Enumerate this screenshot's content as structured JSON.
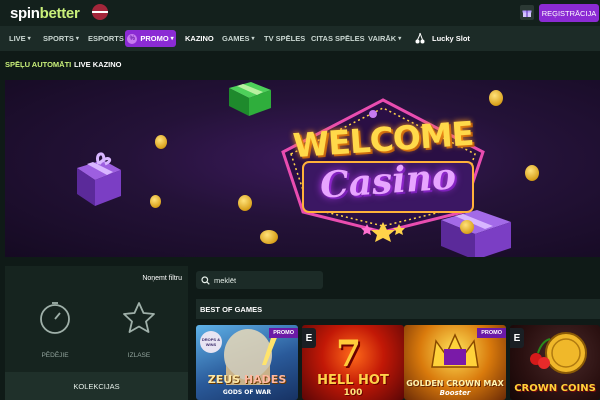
{
  "header": {
    "logo_part1": "spin",
    "logo_part2": "better",
    "flag_icon": "latvia-flag-icon",
    "gift_icon": "gift-icon",
    "register_label": "REĢISTRĀCIJA",
    "colors": {
      "accent": "#8b2bd4",
      "brand_green": "#c9f07a",
      "bg": "#0f1a17"
    }
  },
  "nav": {
    "items": [
      {
        "label": "LIVE",
        "chevron": "▾"
      },
      {
        "label": "SPORTS",
        "chevron": "▾"
      },
      {
        "label": "ESPORTS",
        "chevron": ""
      },
      {
        "label": "PROMO",
        "chevron": "▾",
        "icon": "percent-icon",
        "highlight": true
      },
      {
        "label": "KAZINO",
        "chevron": "",
        "active": true
      },
      {
        "label": "GAMES",
        "chevron": "▾"
      },
      {
        "label": "TV SPĒLES",
        "chevron": ""
      },
      {
        "label": "CITAS SPĒLES",
        "chevron": ""
      },
      {
        "label": "VAIRĀK",
        "chevron": "▾"
      },
      {
        "label": "Lucky Slot",
        "chevron": "",
        "icon": "cherry-icon"
      }
    ]
  },
  "subtabs": [
    {
      "label": "SPĒĻU AUTOMĀTI",
      "active": true
    },
    {
      "label": "LIVE KAZINO",
      "active": false
    }
  ],
  "banner": {
    "line1": "WELCOME",
    "line2": "Casino"
  },
  "filters": {
    "reset_label": "Noņemt filtru",
    "recent_label": "PĒDĒJIE",
    "recent_icon": "clock-icon",
    "favorites_label": "IZLASE",
    "favorites_icon": "star-icon",
    "collections_label": "KOLEKCIJAS"
  },
  "search": {
    "placeholder": "meklēt",
    "icon": "search-icon"
  },
  "games_section": {
    "title": "BEST OF GAMES",
    "promo_badge": "PROMO",
    "provider_badge": "E",
    "games": [
      {
        "title_line1": "ZEUS",
        "title_line2": "HADES",
        "subtitle": "GODS OF WAR",
        "badge": "DROPS & WINS",
        "promo": true
      },
      {
        "title_line1": "HELL HOT",
        "title_line2": "100",
        "subtitle": "",
        "badge": "",
        "promo": false
      },
      {
        "title_line1": "GOLDEN CROWN MAX",
        "title_line2": "",
        "subtitle": "Booster",
        "badge": "",
        "promo": true
      },
      {
        "title_line1": "CROWN COINS",
        "title_line2": "",
        "subtitle": "",
        "badge": "",
        "promo": false
      }
    ]
  }
}
